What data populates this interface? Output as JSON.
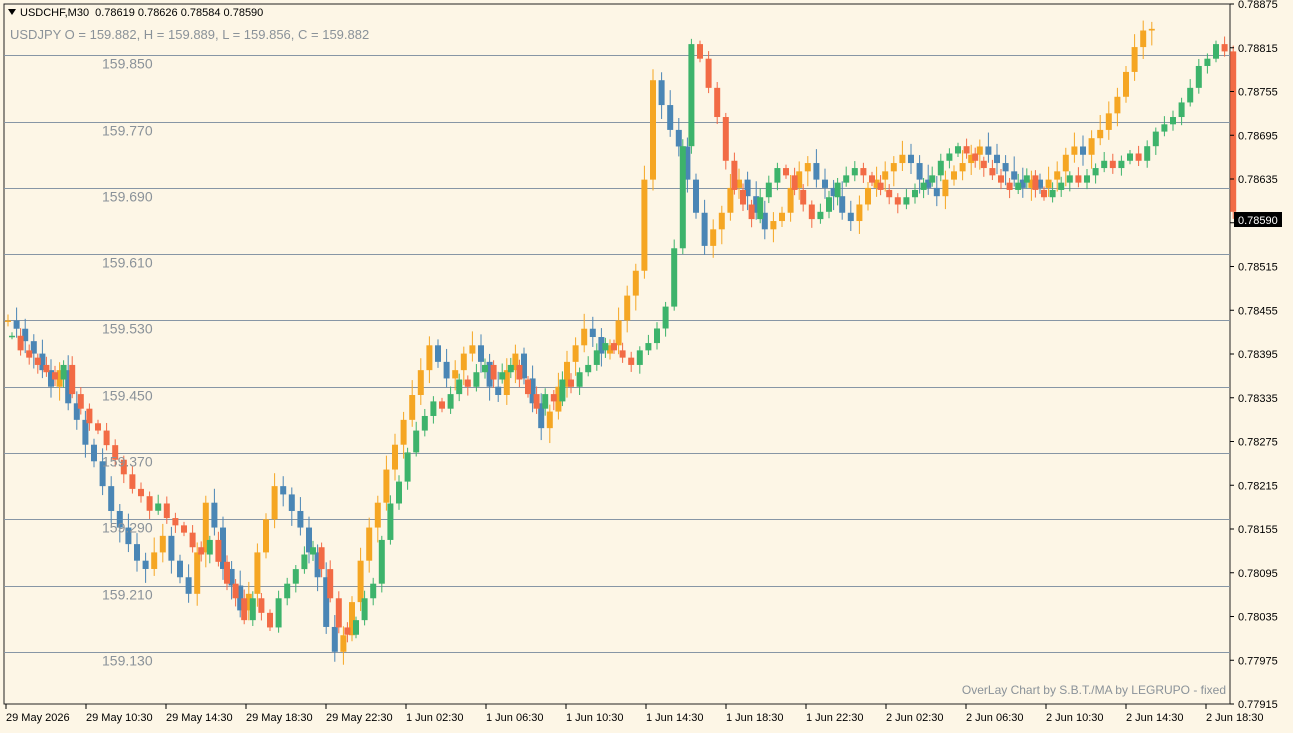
{
  "header": {
    "symbol": "USDCHF,M30",
    "values": "0.78619 0.78626 0.78584 0.78590"
  },
  "overlay": {
    "ohlc_text": "USDJPY O = 159.882, H = 159.889, L = 159.856, C = 159.882",
    "level_labels": [
      "159.850",
      "159.770",
      "159.690",
      "159.610",
      "159.530",
      "159.450",
      "159.370",
      "159.290",
      "159.210",
      "159.130"
    ]
  },
  "footer_note": "OverLay Chart by S.B.T./MA by LEGRUPO - fixed",
  "colors": {
    "background": "#fdf6e6",
    "bull": "#3db36b",
    "bear": "#f26b45",
    "overlay_bull": "#f5a623",
    "overlay_bear": "#4a86b5",
    "level_line": "#8796a5"
  },
  "chart_data": {
    "type": "candlestick",
    "symbol": "USDCHF",
    "timeframe": "M30",
    "y_axis": {
      "ticks": [
        "0.78875",
        "0.78815",
        "0.78755",
        "0.78695",
        "0.78635",
        "0.78575",
        "0.78515",
        "0.78455",
        "0.78395",
        "0.78335",
        "0.78275",
        "0.78215",
        "0.78155",
        "0.78095",
        "0.78035",
        "0.77975",
        "0.77915"
      ],
      "range": [
        0.77915,
        0.78875
      ],
      "current_price": "0.78590"
    },
    "x_axis": {
      "tick_labels": [
        "29 May 2026",
        "29 May 10:30",
        "29 May 14:30",
        "29 May 18:30",
        "29 May 22:30",
        "1 Jun 02:30",
        "1 Jun 06:30",
        "1 Jun 10:30",
        "1 Jun 14:30",
        "1 Jun 18:30",
        "1 Jun 22:30",
        "2 Jun 02:30",
        "2 Jun 06:30",
        "2 Jun 10:30",
        "2 Jun 14:30",
        "2 Jun 18:30"
      ]
    },
    "overlay_levels": [
      159.85,
      159.77,
      159.69,
      159.61,
      159.53,
      159.45,
      159.37,
      159.29,
      159.21,
      159.13
    ],
    "overlay_range": [
      159.067,
      159.912
    ],
    "primary_closes": [
      0.7842,
      0.784,
      0.7839,
      0.7838,
      0.7837,
      0.7836,
      0.7838,
      0.7834,
      0.7832,
      0.783,
      0.7829,
      0.7827,
      0.7825,
      0.7823,
      0.7821,
      0.782,
      0.7818,
      0.7819,
      0.7817,
      0.7816,
      0.7815,
      0.7813,
      0.7812,
      0.7814,
      0.7811,
      0.7808,
      0.7806,
      0.7803,
      0.7806,
      0.7804,
      0.7802,
      0.7806,
      0.7808,
      0.781,
      0.7812,
      0.7813,
      0.781,
      0.7806,
      0.7802,
      0.7801,
      0.7803,
      0.7806,
      0.7808,
      0.7814,
      0.7819,
      0.7822,
      0.7826,
      0.7829,
      0.7831,
      0.7833,
      0.7832,
      0.7834,
      0.7836,
      0.7835,
      0.7837,
      0.7838,
      0.7836,
      0.7837,
      0.7838,
      0.7836,
      0.7834,
      0.7832,
      0.7834,
      0.7833,
      0.7836,
      0.7835,
      0.7837,
      0.7838,
      0.784,
      0.7841,
      0.784,
      0.7839,
      0.7838,
      0.784,
      0.7841,
      0.7843,
      0.7846,
      0.7854,
      0.7868,
      0.7882,
      0.788,
      0.7876,
      0.7872,
      0.7866,
      0.7862,
      0.786,
      0.7858,
      0.7861,
      0.7863,
      0.7865,
      0.7864,
      0.7862,
      0.786,
      0.7858,
      0.7859,
      0.7861,
      0.7863,
      0.7864,
      0.7865,
      0.7864,
      0.7863,
      0.7862,
      0.7861,
      0.786,
      0.7861,
      0.7862,
      0.7863,
      0.7864,
      0.7866,
      0.7867,
      0.7868,
      0.7867,
      0.7866,
      0.7865,
      0.7864,
      0.7863,
      0.7862,
      0.7863,
      0.7864,
      0.7862,
      0.7861,
      0.7862,
      0.7863,
      0.7864,
      0.7863,
      0.7864,
      0.7865,
      0.7866,
      0.7865,
      0.7866,
      0.7867,
      0.7866,
      0.7868,
      0.787,
      0.7871,
      0.7872,
      0.7874,
      0.7876,
      0.7879,
      0.788,
      0.7882,
      0.7881,
      0.7859
    ],
    "overlay_closes": [
      159.53,
      159.52,
      159.505,
      159.49,
      159.47,
      159.45,
      159.47,
      159.43,
      159.41,
      159.38,
      159.36,
      159.33,
      159.3,
      159.28,
      159.26,
      159.24,
      159.23,
      159.25,
      159.27,
      159.24,
      159.22,
      159.2,
      159.25,
      159.31,
      159.28,
      159.23,
      159.21,
      159.18,
      159.2,
      159.25,
      159.29,
      159.33,
      159.32,
      159.3,
      159.28,
      159.25,
      159.22,
      159.16,
      159.13,
      159.15,
      159.19,
      159.24,
      159.28,
      159.31,
      159.35,
      159.38,
      159.41,
      159.44,
      159.47,
      159.5,
      159.48,
      159.46,
      159.47,
      159.49,
      159.5,
      159.48,
      159.45,
      159.44,
      159.47,
      159.49,
      159.46,
      159.43,
      159.4,
      159.42,
      159.45,
      159.48,
      159.5,
      159.52,
      159.51,
      159.49,
      159.5,
      159.53,
      159.56,
      159.59,
      159.7,
      159.82,
      159.79,
      159.76,
      159.74,
      159.7,
      159.66,
      159.62,
      159.64,
      159.66,
      159.69,
      159.7,
      159.68,
      159.66,
      159.64,
      159.65,
      159.66,
      159.69,
      159.71,
      159.72,
      159.7,
      159.69,
      159.68,
      159.66,
      159.65,
      159.67,
      159.69,
      159.7,
      159.71,
      159.72,
      159.73,
      159.72,
      159.7,
      159.69,
      159.68,
      159.7,
      159.71,
      159.72,
      159.73,
      159.74,
      159.73,
      159.72,
      159.71,
      159.7,
      159.69,
      159.7,
      159.69,
      159.7,
      159.71,
      159.73,
      159.74,
      159.73,
      159.75,
      159.76,
      159.78,
      159.8,
      159.83,
      159.86,
      159.88,
      159.882
    ]
  }
}
